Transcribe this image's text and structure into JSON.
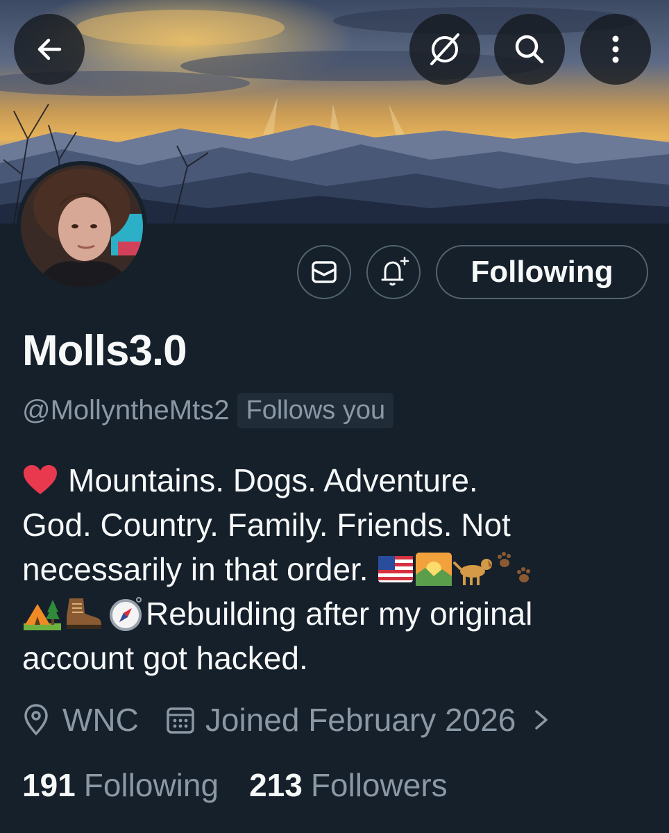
{
  "colors": {
    "background": "#15202b",
    "text_primary": "#f7f9f9",
    "text_secondary": "#8b98a5",
    "border": "#536471",
    "heart": "#e8394e"
  },
  "topbar": {
    "back_icon": "arrow-left-icon",
    "grok_icon": "grok-icon",
    "search_icon": "search-icon",
    "more_icon": "more-vertical-icon"
  },
  "actions": {
    "message_icon": "mail-icon",
    "notify_icon": "bell-plus-icon",
    "follow_label": "Following"
  },
  "profile": {
    "display_name": "Molls3.0",
    "handle": "@MollyntheMts2",
    "follows_you": "Follows you",
    "bio": {
      "line1": "Mountains. Dogs. Adventure.",
      "line2": "God. Country. Family. Friends. Not",
      "line3": "necessarily in that order.",
      "line4": "Rebuilding after my original",
      "line5": "account got hacked."
    },
    "location": "WNC",
    "joined": "Joined February 2026"
  },
  "stats": {
    "following_count": "191",
    "following_label": "Following",
    "followers_count": "213",
    "followers_label": "Followers"
  }
}
